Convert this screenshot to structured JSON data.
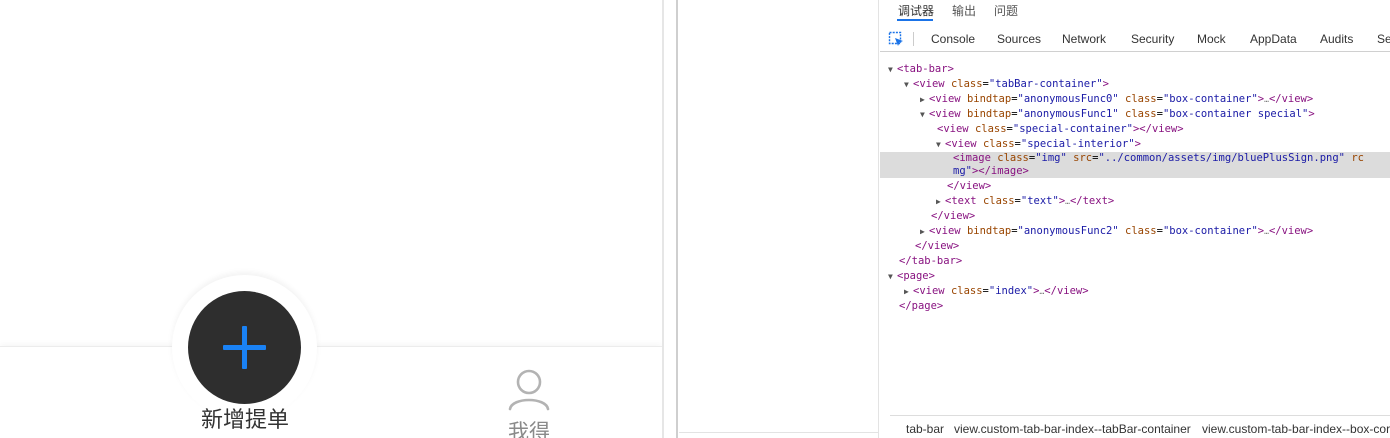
{
  "simulator": {
    "tab_add_label": "新增提单",
    "tab_mine_label": "我得",
    "accent_color": "#1a82f5",
    "button_color": "#2e2e2e"
  },
  "devtools": {
    "top_tabs": [
      "调试器",
      "输出",
      "问题"
    ],
    "panel_tabs": [
      "Console",
      "Sources",
      "Network",
      "Security",
      "Mock",
      "AppData",
      "Audits",
      "Se"
    ],
    "dom": {
      "l1": {
        "tag_open": "<tab-bar>"
      },
      "l2": {
        "tag_open": "<view",
        "a1": "class",
        "v1": "\"tabBar-container\"",
        "close": ">"
      },
      "l3": {
        "tag_open": "<view",
        "a1": "bindtap",
        "v1": "\"anonymousFunc0\"",
        "a2": "class",
        "v2": "\"box-container\"",
        "close": ">",
        "ellipsis": "…",
        "end": "</view>"
      },
      "l4": {
        "tag_open": "<view",
        "a1": "bindtap",
        "v1": "\"anonymousFunc1\"",
        "a2": "class",
        "v2": "\"box-container special\"",
        "close": ">"
      },
      "l5": {
        "tag_open": "<view",
        "a1": "class",
        "v1": "\"special-container\"",
        "close": "></view>"
      },
      "l6": {
        "tag_open": "<view",
        "a1": "class",
        "v1": "\"special-interior\"",
        "close": ">"
      },
      "l7": {
        "tag_open": "<image",
        "a1": "class",
        "v1": "\"img\"",
        "a2": "src",
        "v2": "\"../common/assets/img/bluePlusSign.png\"",
        "a3": "rc",
        "cont": "mg\"",
        "close": "></image>"
      },
      "l8": {
        "tag": "</view>"
      },
      "l9": {
        "tag_open": "<text",
        "a1": "class",
        "v1": "\"text\"",
        "close": ">",
        "ellipsis": "…",
        "end": "</text>"
      },
      "l10": {
        "tag": "</view>"
      },
      "l11": {
        "tag_open": "<view",
        "a1": "bindtap",
        "v1": "\"anonymousFunc2\"",
        "a2": "class",
        "v2": "\"box-container\"",
        "close": ">",
        "ellipsis": "…",
        "end": "</view>"
      },
      "l12": {
        "tag": "</view>"
      },
      "l13": {
        "tag": "</tab-bar>"
      },
      "l14": {
        "tag_open": "<page>"
      },
      "l15": {
        "tag_open": "<view",
        "a1": "class",
        "v1": "\"index\"",
        "close": ">",
        "ellipsis": "…",
        "end": "</view>"
      },
      "l16": {
        "tag": "</page>"
      }
    },
    "breadcrumbs": [
      "tab-bar",
      "view.custom-tab-bar-index--tabBar-container",
      "view.custom-tab-bar-index--box-cor"
    ]
  }
}
